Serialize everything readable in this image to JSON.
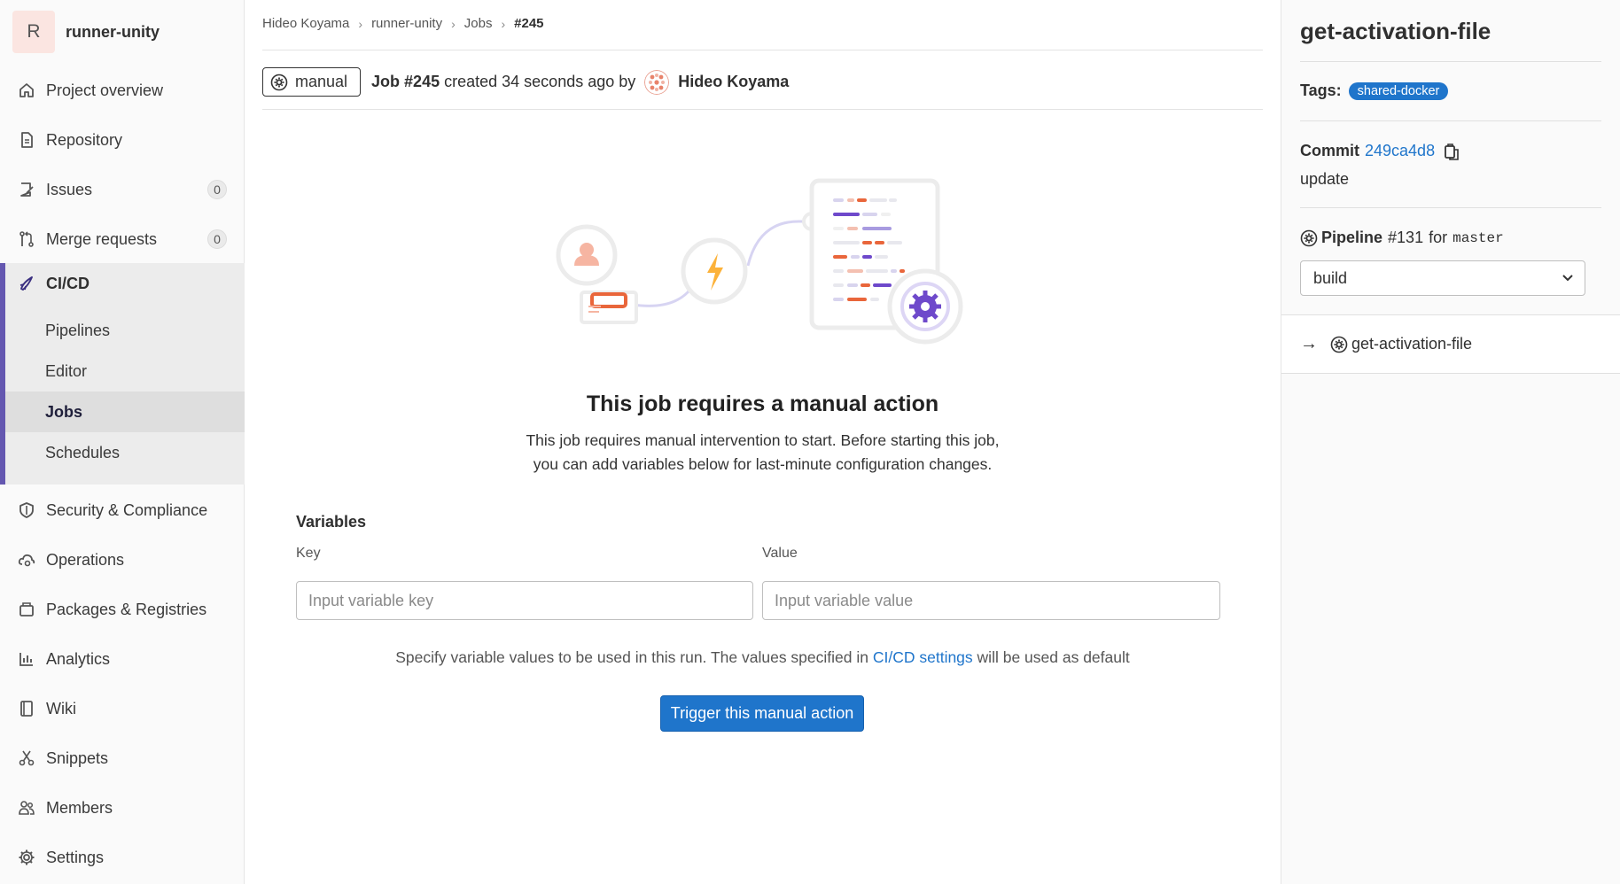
{
  "project": {
    "avatar_letter": "R",
    "name": "runner-unity"
  },
  "sidebar": {
    "items": [
      {
        "label": "Project overview",
        "icon": "home-icon"
      },
      {
        "label": "Repository",
        "icon": "doc-icon"
      },
      {
        "label": "Issues",
        "icon": "issues-icon",
        "count": "0"
      },
      {
        "label": "Merge requests",
        "icon": "merge-request-icon",
        "count": "0"
      },
      {
        "label": "CI/CD",
        "icon": "rocket-icon"
      },
      {
        "label": "Security & Compliance",
        "icon": "shield-icon"
      },
      {
        "label": "Operations",
        "icon": "cloud-gear-icon"
      },
      {
        "label": "Packages & Registries",
        "icon": "package-icon"
      },
      {
        "label": "Analytics",
        "icon": "chart-icon"
      },
      {
        "label": "Wiki",
        "icon": "book-icon"
      },
      {
        "label": "Snippets",
        "icon": "scissors-icon"
      },
      {
        "label": "Members",
        "icon": "users-icon"
      },
      {
        "label": "Settings",
        "icon": "gear-icon"
      }
    ],
    "cicd_sub": [
      "Pipelines",
      "Editor",
      "Jobs",
      "Schedules"
    ],
    "active_sub": "Jobs"
  },
  "breadcrumb": [
    "Hideo Koyama",
    "runner-unity",
    "Jobs",
    "#245"
  ],
  "job_header": {
    "status": "manual",
    "job_label": "Job #245",
    "created_text": "created 34 seconds ago by",
    "user": "Hideo Koyama"
  },
  "empty_state": {
    "title": "This job requires a manual action",
    "description_line1": "This job requires manual intervention to start. Before starting this job,",
    "description_line2": "you can add variables below for last-minute configuration changes."
  },
  "variables": {
    "heading": "Variables",
    "key_label": "Key",
    "value_label": "Value",
    "key_placeholder": "Input variable key",
    "value_placeholder": "Input variable value",
    "help_prefix": "Specify variable values to be used in this run. The values specified in",
    "help_link": "CI/CD settings",
    "help_suffix": "will be used as default"
  },
  "trigger_button": "Trigger this manual action",
  "right_sidebar": {
    "job_name": "get-activation-file",
    "tags_label": "Tags:",
    "tag": "shared-docker",
    "commit_label": "Commit",
    "commit_sha": "249ca4d8",
    "commit_message": "update",
    "pipeline_label": "Pipeline",
    "pipeline_number": "#131",
    "pipeline_for": "for",
    "pipeline_ref": "master",
    "stage_select": "build",
    "job_list_item": "get-activation-file"
  },
  "colors": {
    "accent": "#1f75cb",
    "sidebar_active_border": "#6457b0",
    "illustration_orange": "#e9663b",
    "illustration_purple": "#6e49cb",
    "illustration_yellow": "#fcb23a"
  }
}
